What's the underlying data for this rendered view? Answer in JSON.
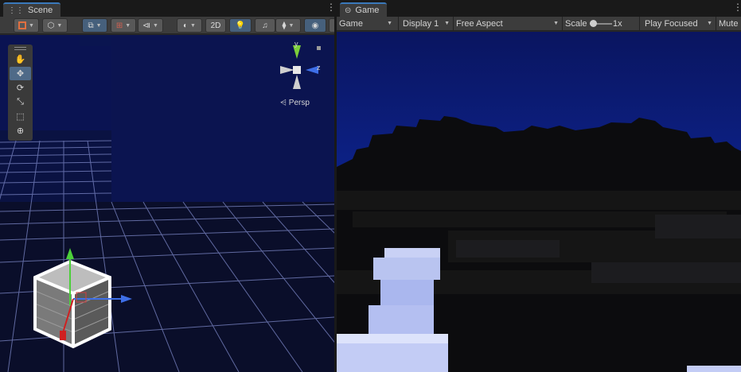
{
  "scene": {
    "tab_label": "Scene",
    "toolbar": {
      "twod_label": "2D"
    },
    "camera_label": "Persp",
    "axes": {
      "y": "y",
      "z": "z"
    }
  },
  "game": {
    "tab_label": "Game",
    "toolbar": {
      "mode": "Game",
      "display": "Display 1",
      "aspect": "Free Aspect",
      "scale_label": "Scale",
      "scale_value": "1x",
      "play_mode": "Play Focused",
      "mute": "Mute"
    }
  },
  "colors": {
    "sky": "#0b1a6e",
    "accent": "#3a79bb",
    "terrain": "#0b0b0b",
    "path": "#b9c4f0"
  }
}
